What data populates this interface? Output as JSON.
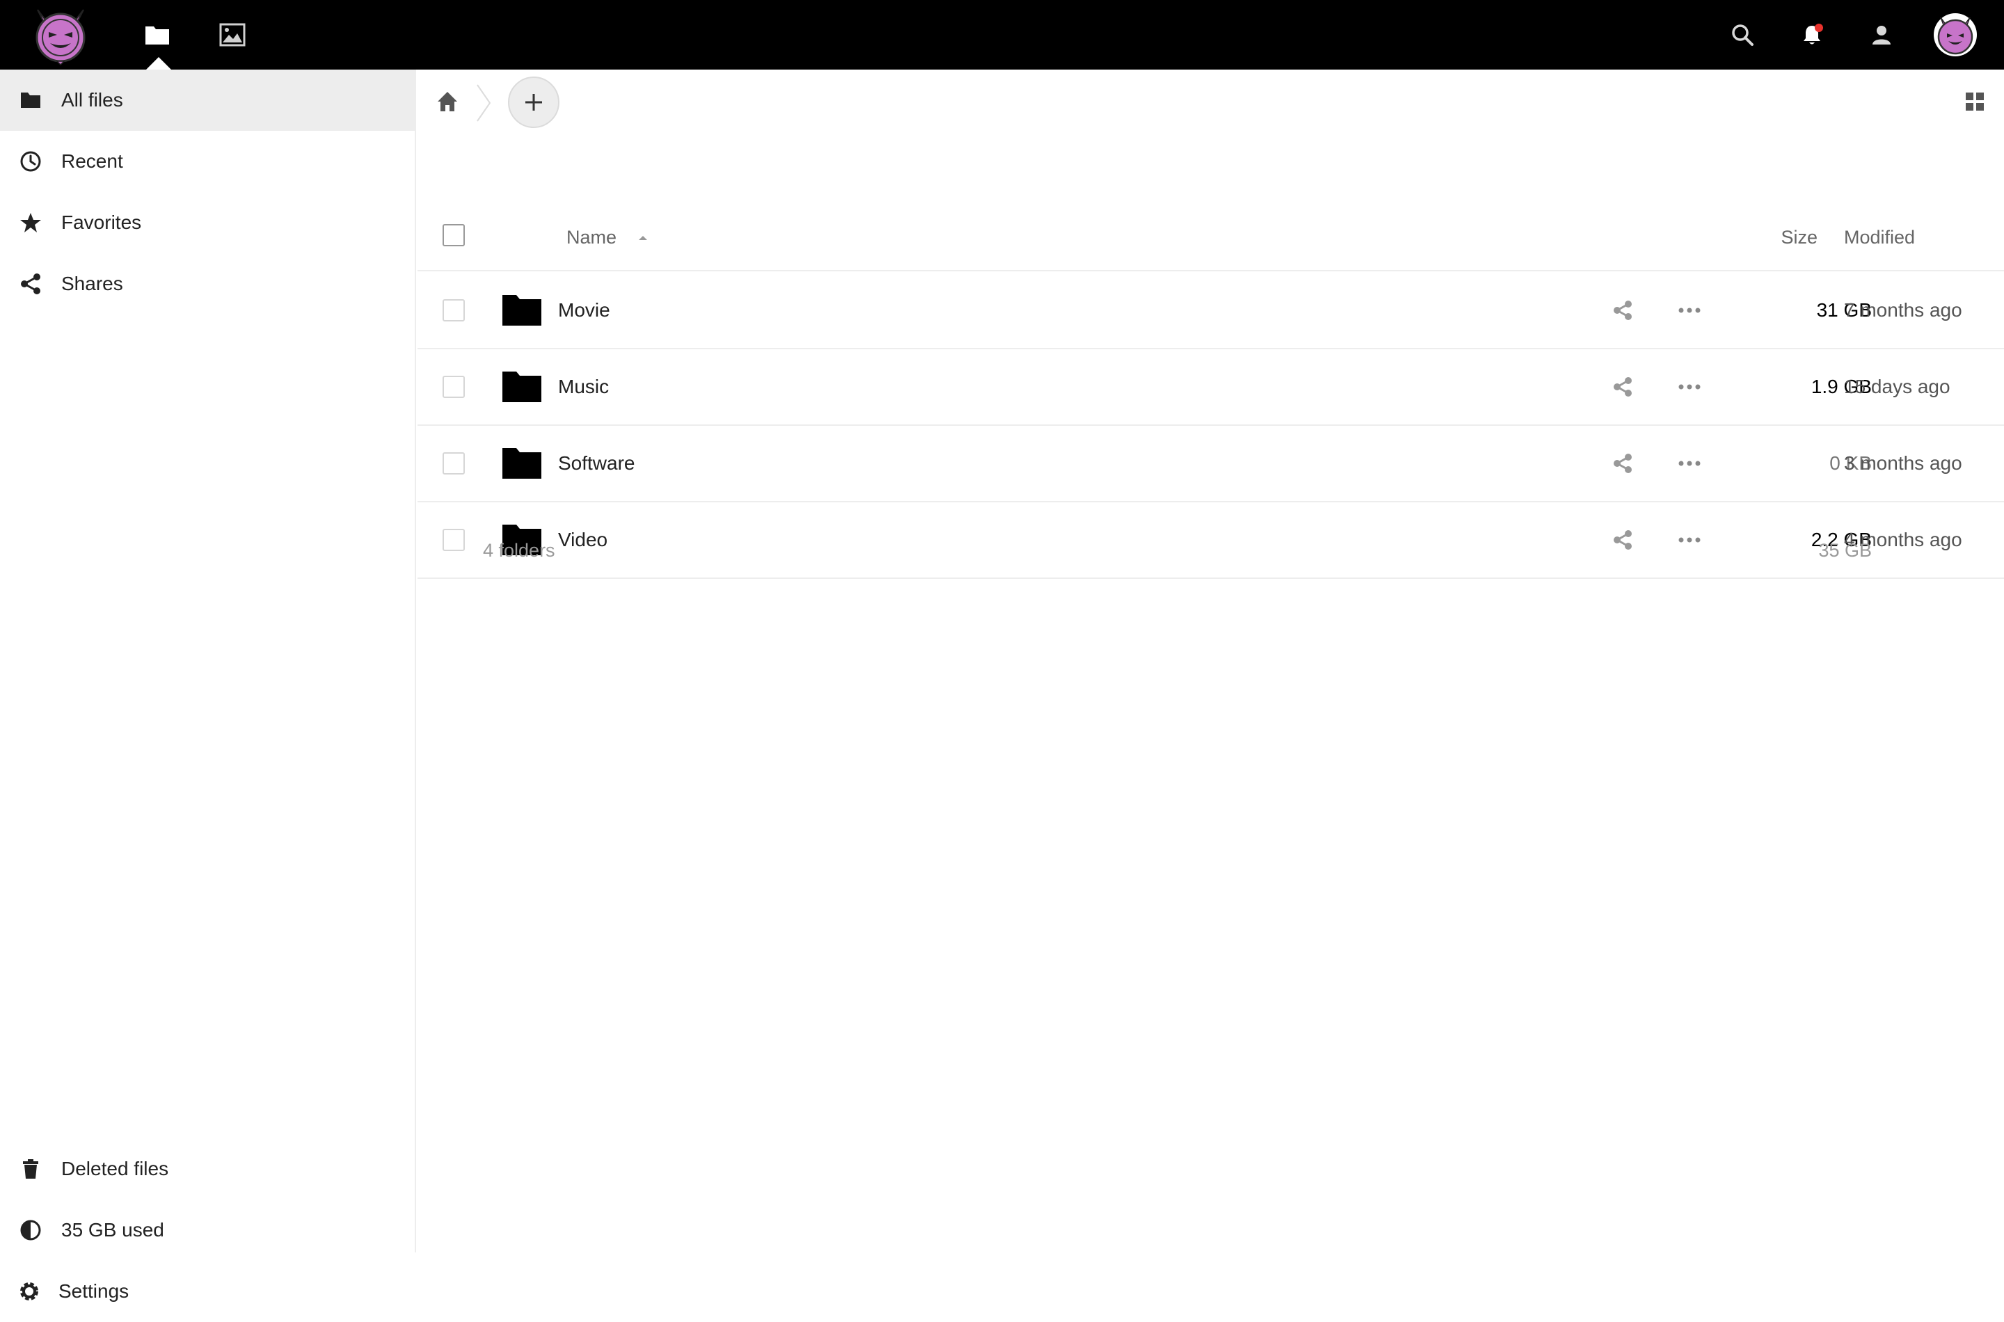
{
  "header": {
    "apps": [
      {
        "name": "Files",
        "icon": "folder-icon",
        "active": true
      },
      {
        "name": "Photos",
        "icon": "image-icon",
        "active": false
      }
    ],
    "actions": [
      "search-icon",
      "bell-icon",
      "contacts-icon",
      "avatar"
    ],
    "notification_dot_color": "#e9322d",
    "brand_color": "#c774c9"
  },
  "sidebar": {
    "items": [
      {
        "label": "All files",
        "icon": "folder-icon",
        "active": true
      },
      {
        "label": "Recent",
        "icon": "clock-icon"
      },
      {
        "label": "Favorites",
        "icon": "star-icon"
      },
      {
        "label": "Shares",
        "icon": "share-icon"
      }
    ],
    "bottom": {
      "deleted": "Deleted files",
      "quota": "35 GB used",
      "settings": "Settings"
    }
  },
  "files": {
    "columns": {
      "name": "Name",
      "size": "Size",
      "modified": "Modified"
    },
    "rows": [
      {
        "name": "Movie",
        "size": "31 GB",
        "modified": "7 months ago"
      },
      {
        "name": "Music",
        "size": "1.9 GB",
        "modified": "15 days ago"
      },
      {
        "name": "Software",
        "size": "0 KB",
        "modified": "3 months ago"
      },
      {
        "name": "Video",
        "size": "2.2 GB",
        "modified": "4 months ago"
      }
    ],
    "summary": {
      "count": "4 folders",
      "size": "35 GB"
    }
  }
}
